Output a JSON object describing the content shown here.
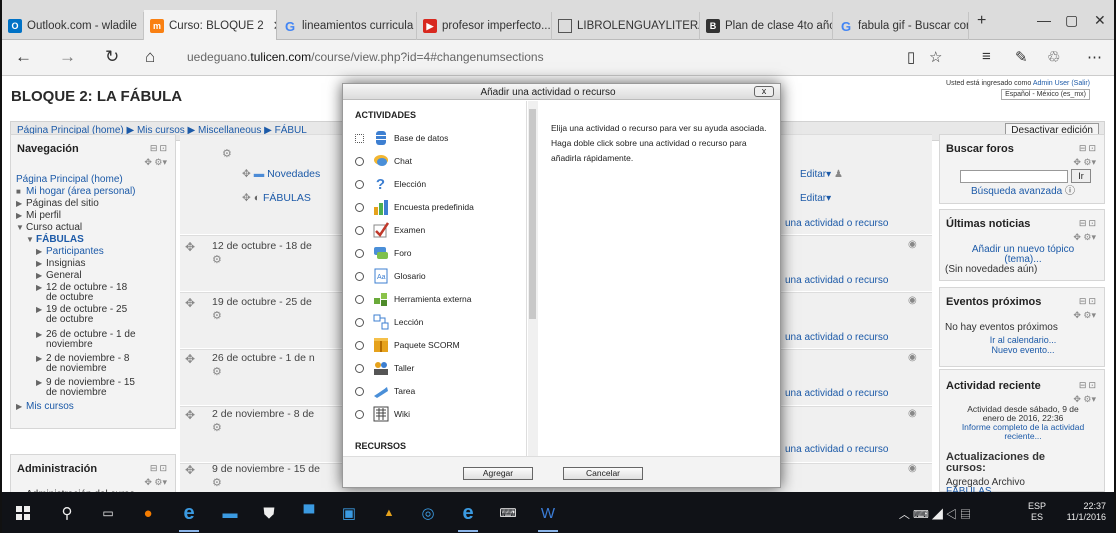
{
  "tabs": [
    {
      "label": "Outlook.com - wladile",
      "icon": "outlook-icon",
      "color": "#0072c6"
    },
    {
      "label": "Curso: BLOQUE 2",
      "icon": "moodle-icon",
      "color": "#f98012"
    },
    {
      "label": "lineamientos curricula",
      "icon": "google-icon",
      "color": "#4285f4"
    },
    {
      "label": "profesor imperfecto...",
      "icon": "youtube-icon",
      "color": "#d8281f"
    },
    {
      "label": "LIBROLENGUAYLITERA",
      "icon": "document-icon",
      "color": "#555555"
    },
    {
      "label": "Plan de clase 4to año",
      "icon": "blogger-icon",
      "color": "#333333"
    },
    {
      "label": "fabula gif - Buscar cor",
      "icon": "google-icon",
      "color": "#4285f4"
    }
  ],
  "address": {
    "prefix": "uedeguano.",
    "domain": "tulicen.com",
    "path": "/course/view.php?id=4#changenumsections"
  },
  "page": {
    "title": "BLOQUE 2: LA FÁBULA",
    "login_line1_prefix": "Usted está ingresado como ",
    "login_user": "Admin User (Salir)",
    "language": "Español - México (es_mx)",
    "breadcrumb": "Página Principal (home) ▶ Mis cursos ▶ Miscellaneous ▶ FÁBUL",
    "edit_button": "Desactivar edición"
  },
  "navigation": {
    "title": "Navegación",
    "items": [
      "Página Principal (home)",
      "Mi hogar (área personal)",
      "Páginas del sitio",
      "Mi perfil",
      "Curso actual",
      "FÁBULAS",
      "Participantes",
      "Insignias",
      "General",
      "12 de octubre - 18",
      "de octubre",
      "19 de octubre - 25",
      "de octubre",
      "26 de octubre - 1 de",
      "noviembre",
      "2 de noviembre - 8",
      "de noviembre",
      "9 de noviembre - 15",
      "de noviembre",
      "Mis cursos"
    ]
  },
  "admin": {
    "title": "Administración",
    "item": "Administración del curso"
  },
  "course": {
    "forum_label": "Novedades",
    "fabulas_label": "FÁBULAS",
    "edit_label": "Editar",
    "add_link": "una actividad o recurso",
    "sections": [
      "12 de octubre - 18 de",
      "19 de octubre - 25 de",
      "26 de octubre - 1 de n",
      "2 de noviembre - 8 de",
      "9 de noviembre - 15 de"
    ]
  },
  "right": {
    "search_title": "Buscar foros",
    "search_go": "Ir",
    "search_advanced": "Búsqueda avanzada",
    "news_title": "Últimas noticias",
    "news_add": "Añadir un nuevo tópico",
    "news_add2": "(tema)...",
    "news_none": "(Sin novedades aún)",
    "events_title": "Eventos próximos",
    "events_none": "No hay eventos próximos",
    "events_cal": "Ir al calendario...",
    "events_new": "Nuevo evento...",
    "recent_title": "Actividad reciente",
    "recent_since1": "Actividad desde sábado, 9 de",
    "recent_since2": "enero de 2016, 22:36",
    "recent_report1": "Informe completo de la actividad",
    "recent_report2": "reciente...",
    "updates_title": "Actualizaciones de",
    "updates_title2": "cursos:",
    "updates_item": "Agregado Archivo",
    "updates_item2": "FÁBULAS"
  },
  "modal": {
    "title": "Añadir una actividad o recurso",
    "close": "x",
    "activities_heading": "ACTIVIDADES",
    "activities": [
      {
        "label": "Base de datos",
        "icon": "database-icon"
      },
      {
        "label": "Chat",
        "icon": "chat-icon"
      },
      {
        "label": "Elección",
        "icon": "question-icon"
      },
      {
        "label": "Encuesta predefinida",
        "icon": "bar-chart-icon"
      },
      {
        "label": "Examen",
        "icon": "quiz-check-icon"
      },
      {
        "label": "Foro",
        "icon": "forum-icon"
      },
      {
        "label": "Glosario",
        "icon": "glossary-icon"
      },
      {
        "label": "Herramienta externa",
        "icon": "puzzle-icon"
      },
      {
        "label": "Lección",
        "icon": "lesson-icon"
      },
      {
        "label": "Paquete SCORM",
        "icon": "package-icon"
      },
      {
        "label": "Taller",
        "icon": "workshop-icon"
      },
      {
        "label": "Tarea",
        "icon": "assignment-icon"
      },
      {
        "label": "Wiki",
        "icon": "wiki-icon"
      }
    ],
    "resources_heading": "RECURSOS",
    "help": "Elija una actividad o recurso para ver su ayuda asociada. Haga doble click sobre una actividad o recurso para añadirla rápidamente.",
    "add_button": "Agregar",
    "cancel_button": "Cancelar"
  },
  "tray": {
    "lang": "ESP",
    "lang2": "ES",
    "time": "22:37",
    "date": "11/1/2016"
  }
}
